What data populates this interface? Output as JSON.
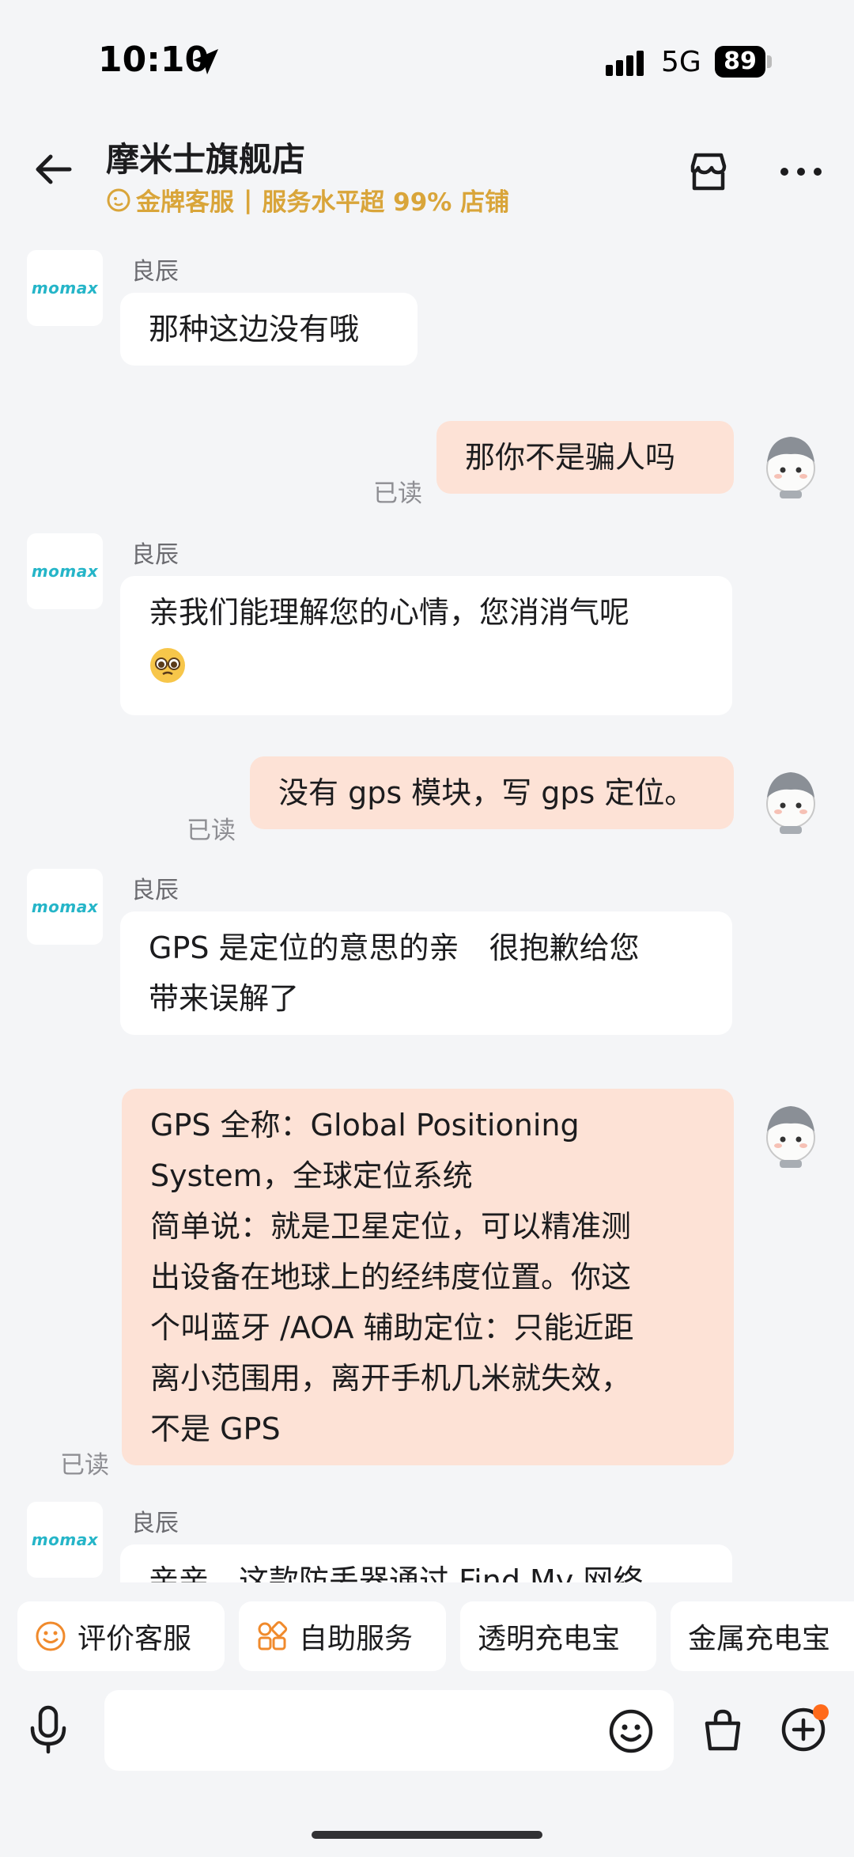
{
  "status": {
    "time": "10:10",
    "network": "5G",
    "battery": "89"
  },
  "header": {
    "title": "摩米士旗舰店",
    "badge": "金牌客服",
    "service": "服务水平超 99% 店铺"
  },
  "shop_logo": "momax",
  "messages": [
    {
      "sender": "良辰",
      "text": "那种这边没有哦"
    },
    {
      "text": "那你不是骗人吗",
      "read": "已读"
    },
    {
      "sender": "良辰",
      "line1": "亲我们能理解您的心情，您消消气呢",
      "emoji": "pleading-face"
    },
    {
      "text": "没有 gps 模块，写 gps 定位。",
      "read": "已读"
    },
    {
      "sender": "良辰",
      "line1": "GPS 是定位的意思的亲　很抱歉给您",
      "line2": "带来误解了"
    },
    {
      "lines": [
        "GPS 全称：Global Positioning",
        "System，全球定位系统",
        "简单说：就是卫星定位，可以精准测",
        "出设备在地球上的经纬度位置。你这",
        "个叫蓝牙 /AOA 辅助定位：只能近距",
        "离小范围用，离开手机几米就失效，",
        "不是 GPS"
      ],
      "read": "已读"
    },
    {
      "sender": "良辰",
      "text": "亲亲，这款防丢器通过 Find My 网络"
    }
  ],
  "chips": [
    {
      "label": "评价客服",
      "icon": "smiley-icon"
    },
    {
      "label": "自助服务",
      "icon": "grid-icon"
    },
    {
      "label": "透明充电宝"
    },
    {
      "label": "金属充电宝"
    }
  ],
  "colors": {
    "accent_gold": "#d9a53a",
    "outgoing_bubble": "#fde2d6",
    "incoming_bubble": "#ffffff",
    "logo_teal": "#25b5c8",
    "notify_dot": "#ff6a1a"
  }
}
